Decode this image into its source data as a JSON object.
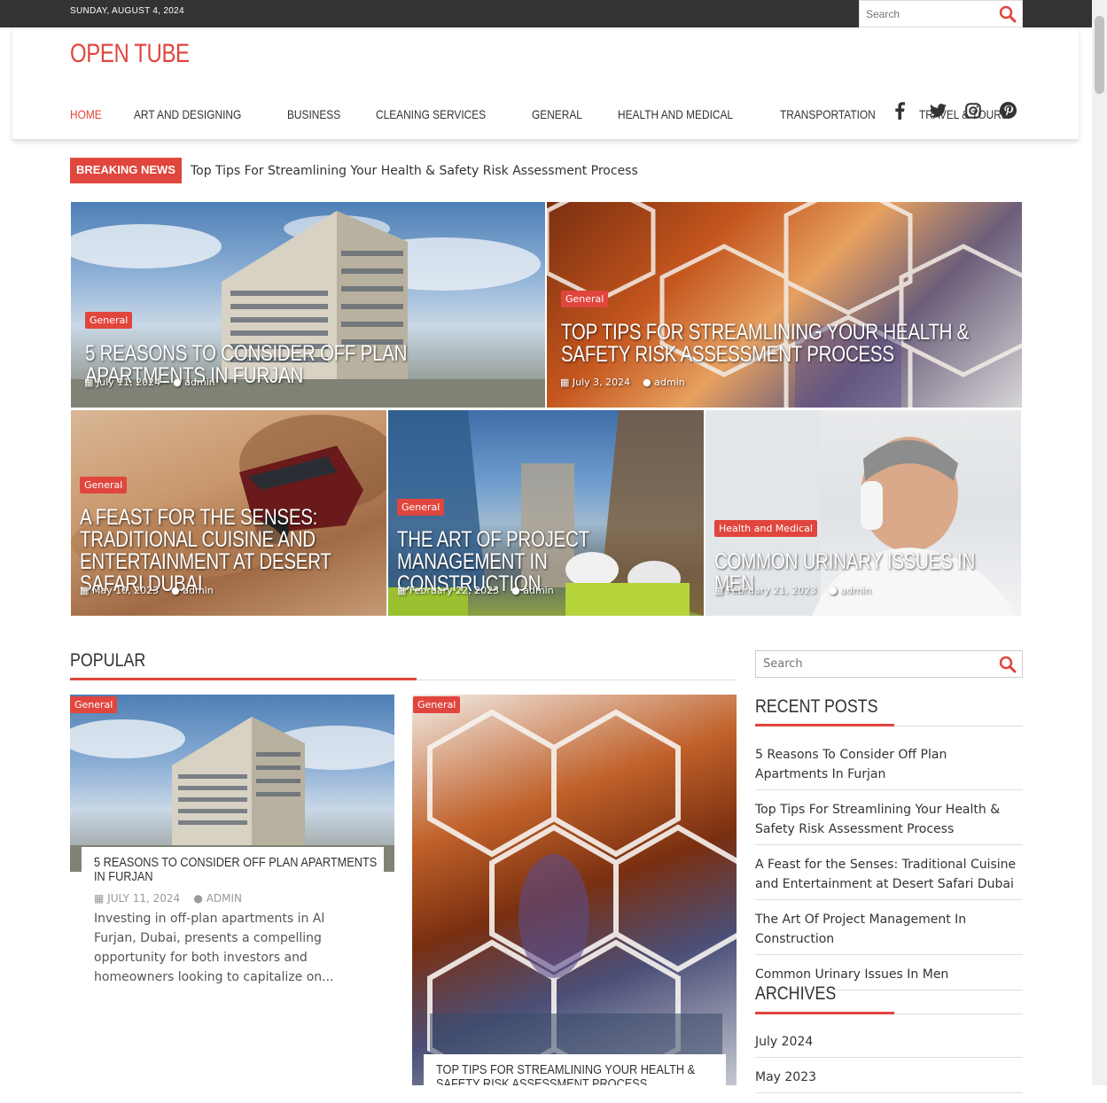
{
  "topbar": {
    "date": "SUNDAY, AUGUST 4, 2024",
    "search_placeholder": "Search"
  },
  "site": {
    "title": "OPEN TUBE"
  },
  "nav": {
    "items": [
      "HOME",
      "ART AND DESIGNING",
      "BUSINESS",
      "CLEANING SERVICES",
      "GENERAL",
      "HEALTH AND MEDICAL",
      "TRANSPORTATION",
      "TRAVEL & TOURS"
    ]
  },
  "social": {
    "icons": [
      "facebook-icon",
      "twitter-icon",
      "instagram-icon",
      "pinterest-icon"
    ]
  },
  "breaking": {
    "label": "BREAKING NEWS",
    "text": "Top Tips For Streamlining Your Health & Safety Risk Assessment Process"
  },
  "featured": [
    {
      "category": "General",
      "title": "5 REASONS TO CONSIDER OFF PLAN APARTMENTS IN FURJAN",
      "date": "July 11, 2024",
      "author": "admin"
    },
    {
      "category": "General",
      "title": "TOP TIPS FOR STREAMLINING YOUR HEALTH & SAFETY RISK ASSESSMENT PROCESS",
      "date": "July 3, 2024",
      "author": "admin"
    },
    {
      "category": "General",
      "title": "A FEAST FOR THE SENSES: TRADITIONAL CUISINE AND ENTERTAINMENT AT DESERT SAFARI DUBAI",
      "date": "May 10, 2023",
      "author": "admin"
    },
    {
      "category": "General",
      "title": "THE ART OF PROJECT MANAGEMENT IN CONSTRUCTION",
      "date": "February 22, 2023",
      "author": "admin"
    },
    {
      "category": "Health and Medical",
      "title": "COMMON URINARY ISSUES IN MEN",
      "date": "February 21, 2023",
      "author": "admin"
    }
  ],
  "popular": {
    "heading": "POPULAR",
    "cards": [
      {
        "category": "General",
        "title": "5 REASONS TO CONSIDER OFF PLAN APARTMENTS IN FURJAN",
        "date": "JULY 11, 2024",
        "author": "ADMIN",
        "excerpt": "Investing in off-plan apartments in Al Furjan, Dubai, presents a compelling opportunity for both investors and homeowners looking to capitalize on..."
      },
      {
        "category": "General",
        "title": "TOP TIPS FOR STREAMLINING YOUR HEALTH & SAFETY RISK ASSESSMENT PROCESS"
      }
    ]
  },
  "sidebar": {
    "search_placeholder": "Search",
    "recent_heading": "RECENT POSTS",
    "recent": [
      "5 Reasons To Consider Off Plan Apartments In Furjan",
      "Top Tips For Streamlining Your Health & Safety Risk Assessment Process",
      "A Feast for the Senses: Traditional Cuisine and Entertainment at Desert Safari Dubai",
      "The Art Of Project Management In Construction",
      "Common Urinary Issues In Men"
    ],
    "archives_heading": "ARCHIVES",
    "archives": [
      "July 2024",
      "May 2023"
    ]
  },
  "colors": {
    "accent": "#e0463d",
    "topbar": "#333333"
  }
}
